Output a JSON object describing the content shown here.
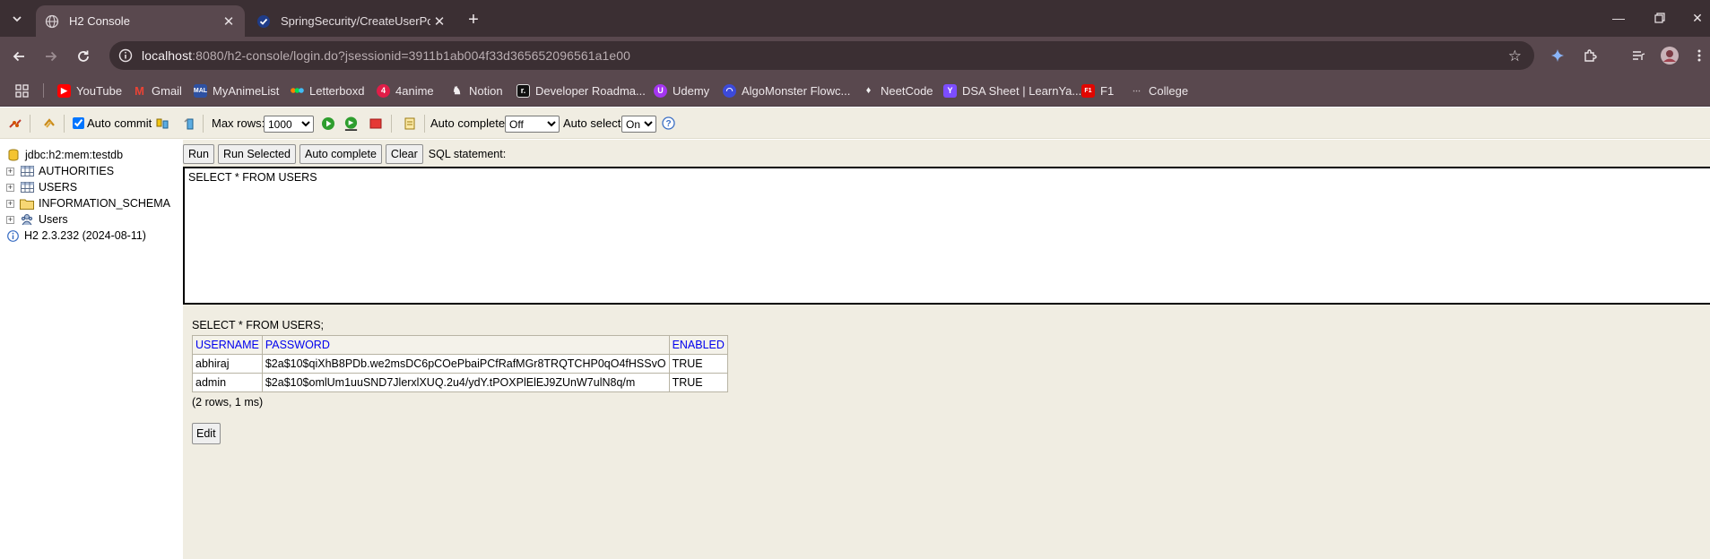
{
  "browser": {
    "tabs": [
      {
        "title": "H2 Console",
        "active": true
      },
      {
        "title": "SpringSecurity/CreateUserPostI",
        "active": false
      }
    ],
    "url_host": "localhost",
    "url_rest": ":8080/h2-console/login.do?jsessionid=3911b1ab004f33d365652096561a1e00",
    "bookmarks": [
      {
        "label": "YouTube",
        "icon": "youtube-icon",
        "color": "#ff0000"
      },
      {
        "label": "Gmail",
        "icon": "gmail-icon",
        "color": "#ea4335"
      },
      {
        "label": "MyAnimeList",
        "icon": "myanimelist-icon",
        "color": "#2e51a2"
      },
      {
        "label": "Letterboxd",
        "icon": "letterboxd-icon",
        "color": "#00c030"
      },
      {
        "label": "4anime",
        "icon": "4anime-icon",
        "color": "#e11d48"
      },
      {
        "label": "Notion",
        "icon": "notion-icon",
        "color": "#ffffff"
      },
      {
        "label": "Developer Roadma...",
        "icon": "roadmap-icon",
        "color": "#111111"
      },
      {
        "label": "Udemy",
        "icon": "udemy-icon",
        "color": "#a435f0"
      },
      {
        "label": "AlgoMonster Flowc...",
        "icon": "algomonster-icon",
        "color": "#5b6cff"
      },
      {
        "label": "NeetCode",
        "icon": "neetcode-icon",
        "color": "#f5f5f5"
      },
      {
        "label": "DSA Sheet | LearnYa...",
        "icon": "learnyard-icon",
        "color": "#7c4dff"
      },
      {
        "label": "F1",
        "icon": "f1-icon",
        "color": "#e10600"
      },
      {
        "label": "College",
        "icon": "college-icon",
        "color": "#9aa0a6"
      }
    ]
  },
  "toolbar": {
    "auto_commit_label": "Auto commit",
    "auto_commit_checked": true,
    "max_rows_label": "Max rows:",
    "max_rows_value": "1000",
    "auto_complete_label": "Auto complete",
    "auto_complete_value": "Off",
    "auto_select_label": "Auto select",
    "auto_select_value": "On"
  },
  "tree": {
    "connection": "jdbc:h2:mem:testdb",
    "items": [
      "AUTHORITIES",
      "USERS",
      "INFORMATION_SCHEMA",
      "Users"
    ],
    "version": "H2 2.3.232 (2024-08-11)"
  },
  "query": {
    "run_label": "Run",
    "run_selected_label": "Run Selected",
    "auto_complete_label": "Auto complete",
    "clear_label": "Clear",
    "sql_statement_label": "SQL statement:",
    "sql_text": "SELECT * FROM USERS"
  },
  "result": {
    "title": "SELECT * FROM USERS;",
    "columns": [
      "USERNAME",
      "PASSWORD",
      "ENABLED"
    ],
    "rows": [
      [
        "abhiraj",
        "$2a$10$qiXhB8PDb.we2msDC6pCOePbaiPCfRafMGr8TRQTCHP0qO4fHSSvO",
        "TRUE"
      ],
      [
        "admin",
        "$2a$10$omlUm1uuSND7JlerxlXUQ.2u4/ydY.tPOXPlElEJ9ZUnW7ulN8q/m",
        "TRUE"
      ]
    ],
    "row_count": "(2 rows, 1 ms)",
    "edit_label": "Edit"
  }
}
